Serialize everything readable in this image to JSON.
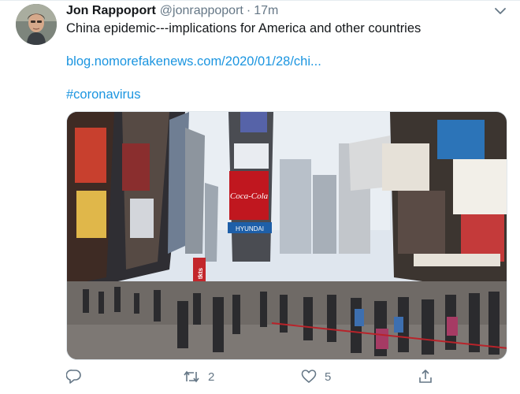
{
  "tweet": {
    "display_name": "Jon Rappoport",
    "handle": "@jonrappoport",
    "separator": "·",
    "time": "17m",
    "text": "China epidemic---implications for America and other countries",
    "link": "blog.nomorefakenews.com/2020/01/28/chi...",
    "hashtag": "#coronavirus"
  },
  "media": {
    "billboard_brand": "Coca-Cola",
    "store_sign": "HYUNDAI",
    "side_sign": "tkts"
  },
  "actions": {
    "reply_count": "",
    "retweet_count": "2",
    "like_count": "5"
  },
  "icons": {
    "menu": "chevron-down-icon",
    "reply": "reply-icon",
    "retweet": "retweet-icon",
    "like": "heart-icon",
    "share": "share-icon"
  },
  "colors": {
    "link": "#1b95e0",
    "secondary_text": "#657786",
    "primary_text": "#14171a"
  }
}
